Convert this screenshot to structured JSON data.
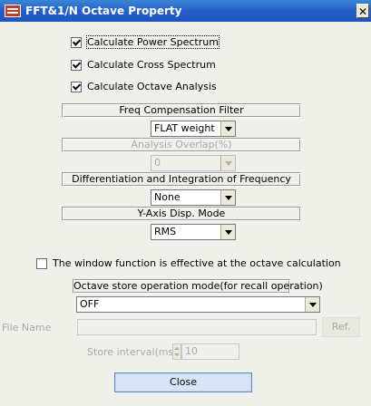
{
  "window": {
    "title": "FFT&1/N Octave Property",
    "close_glyph": "✕"
  },
  "options": {
    "power_spectrum": {
      "label": "Calculate Power Spectrum",
      "checked": true
    },
    "cross_spectrum": {
      "label": "Calculate Cross Spectrum",
      "checked": true
    },
    "octave_analysis": {
      "label": "Calculate Octave Analysis",
      "checked": true
    }
  },
  "freq_compensation": {
    "header": "Freq Compensation Filter",
    "value": "FLAT weight"
  },
  "analysis_overlap": {
    "header": "Analysis Overlap(%)",
    "value": "0"
  },
  "differentiation": {
    "header": "Differentiation and Integration of Frequency",
    "value": "None"
  },
  "y_axis": {
    "header": "Y-Axis Disp. Mode",
    "value": "RMS"
  },
  "window_function": {
    "label": "The window function is effective at the octave calculation",
    "checked": false
  },
  "octave_store": {
    "header": "Octave store operation mode(for recall operation)",
    "value": "OFF"
  },
  "file_name": {
    "label": "File Name",
    "value": "",
    "ref_button": "Ref."
  },
  "store_interval": {
    "label": "Store interval(ms)",
    "value": "10"
  },
  "close_button": "Close"
}
